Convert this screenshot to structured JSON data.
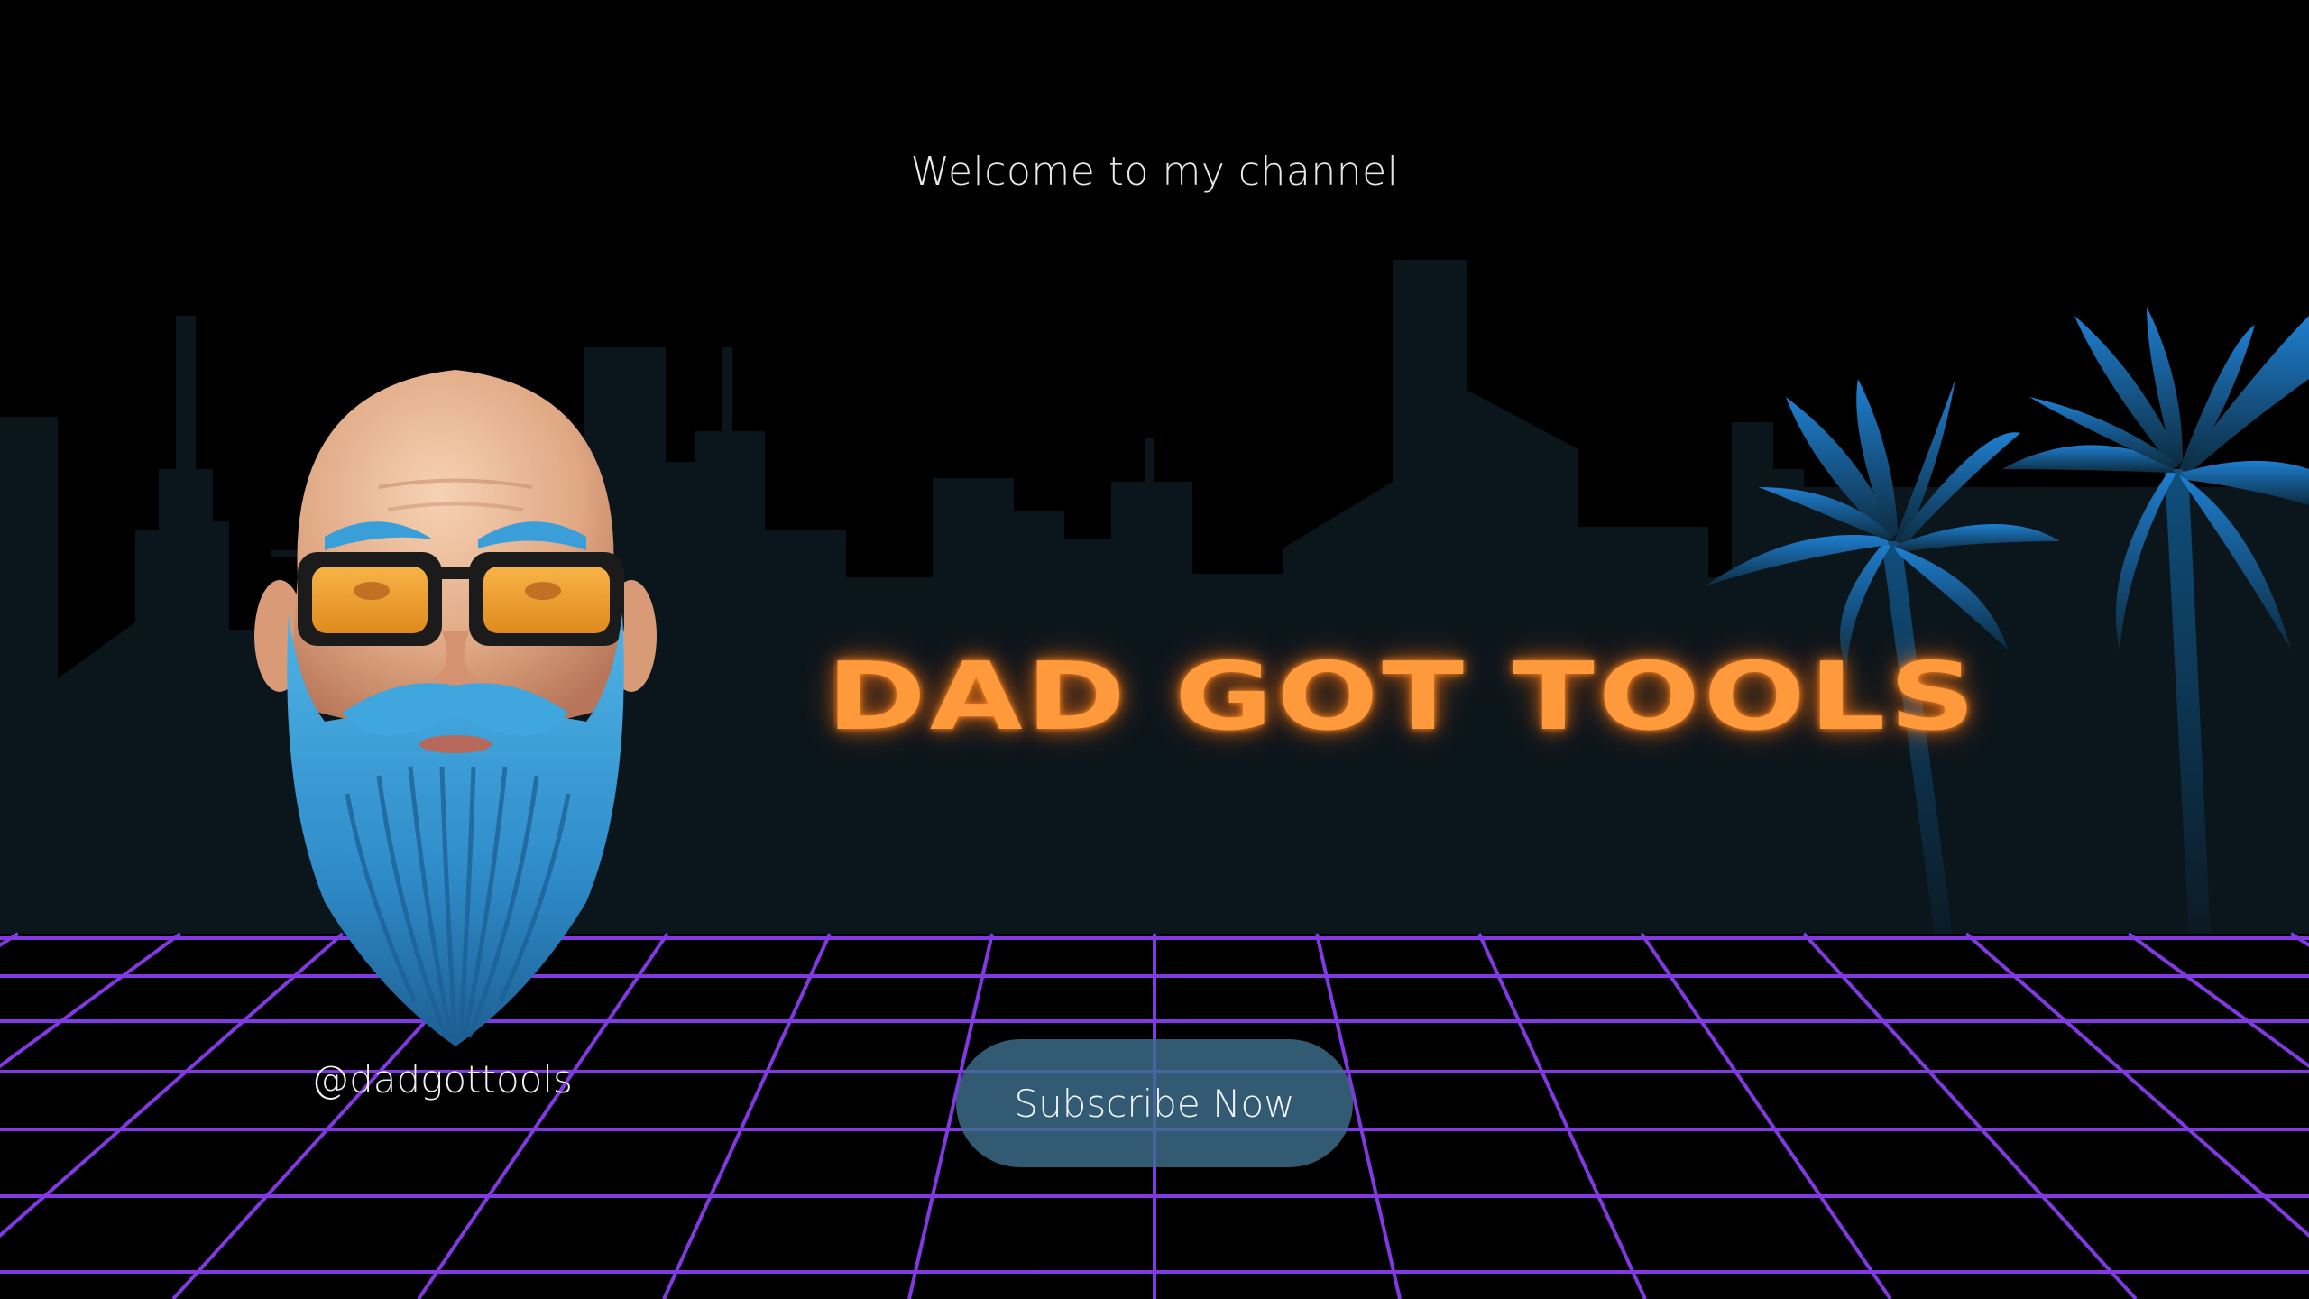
{
  "banner": {
    "welcome_text": "Welcome to my channel",
    "title": "DAD GOT TOOLS",
    "handle": "@dadgottools",
    "subscribe_label": "Subscribe Now"
  },
  "colors": {
    "background": "#000000",
    "skyline": "#0b151c",
    "palm_top": "#1f7fd1",
    "palm_bottom": "#0c2b3e",
    "grid": "#8a3cf0",
    "title_glow": "#ff9a3c",
    "button": "#3e6e8c",
    "beard": "#3a9ed8",
    "lens": "#f2a533"
  },
  "icons": {
    "avatar": "bearded-man-avatar",
    "palms": "palm-tree-icon",
    "city": "city-skyline"
  }
}
